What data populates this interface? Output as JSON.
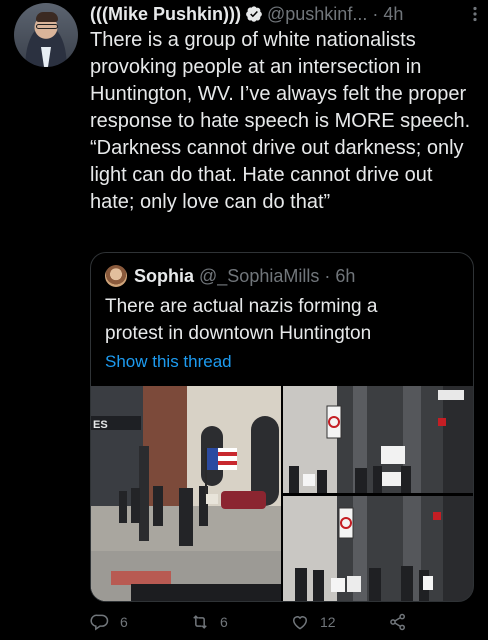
{
  "tweet": {
    "author_name": "(((Mike Pushkin)))",
    "handle": "@pushkinf...",
    "separator": "·",
    "time": "4h",
    "text": "There is a group of white nationalists provoking people at an intersection in Huntington, WV. I’ve always felt the proper response to hate speech is MORE speech. “Darkness cannot drive out darkness; only light can do that. Hate cannot drive out hate; only love can do that”"
  },
  "quote": {
    "author_name": "Sophia",
    "handle": "@_SophiaMills",
    "separator": "·",
    "time": "6h",
    "text": "There are actual nazis forming a protest in downtown Huntington",
    "show_thread": "Show this thread"
  },
  "media": {
    "sign_text": "ES"
  },
  "actions": {
    "replies": "6",
    "retweets": "6",
    "likes": "12"
  },
  "colors": {
    "background": "#000000",
    "text": "#e7e9ea",
    "muted": "#71767b",
    "link": "#1d9bf0",
    "border": "#2f3336"
  }
}
